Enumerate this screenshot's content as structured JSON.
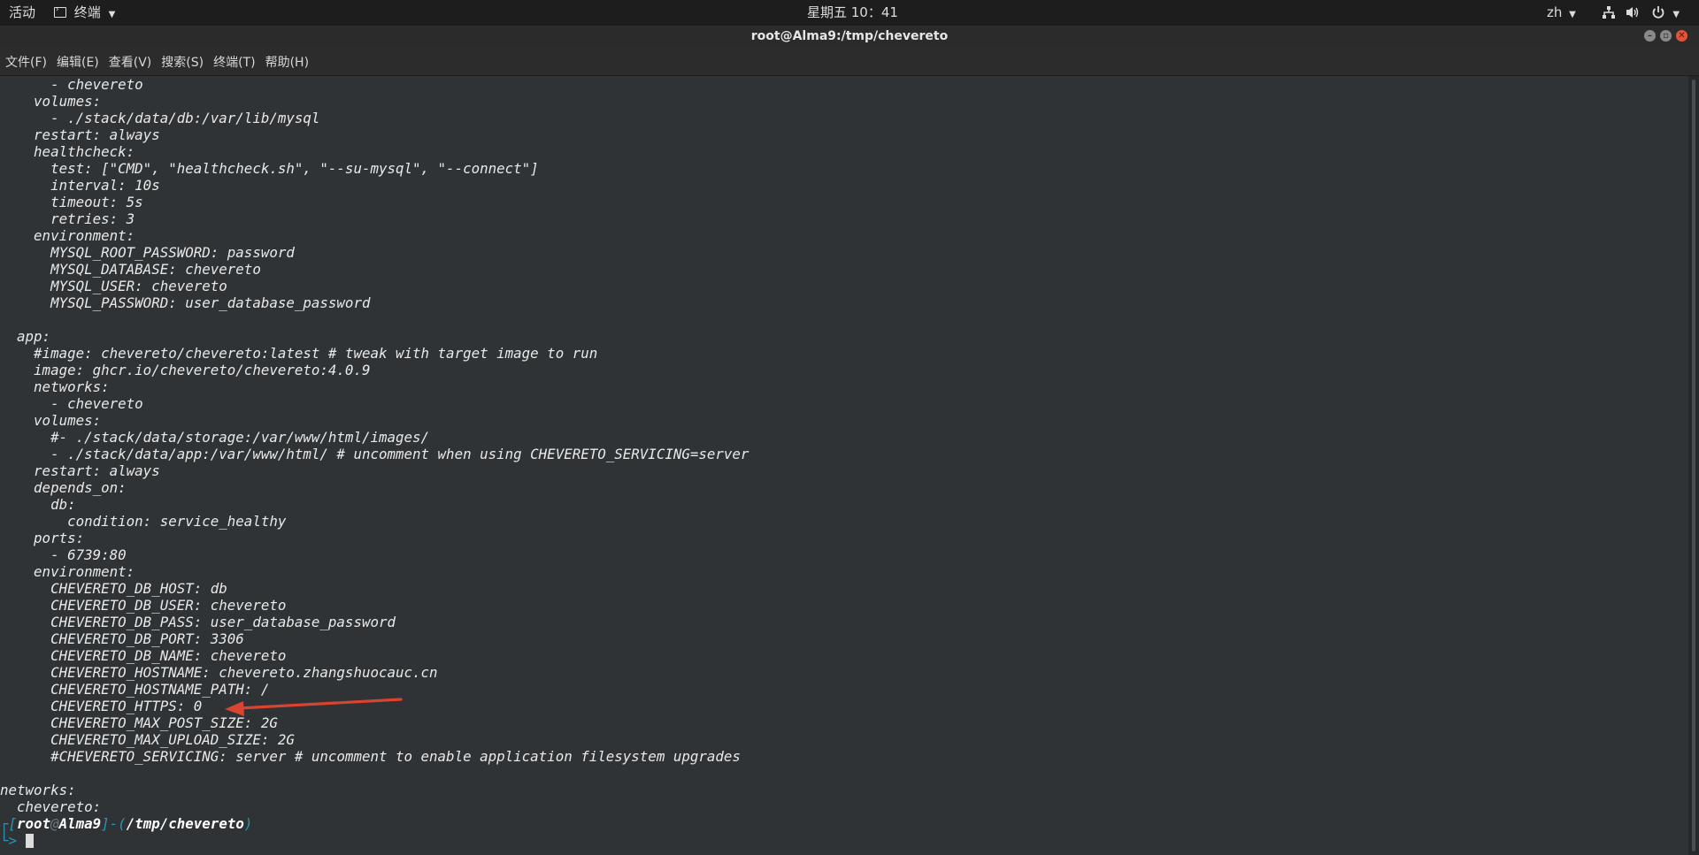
{
  "topbar": {
    "activities": "活动",
    "app_menu": "终端",
    "clock": "星期五 10：41",
    "input_method": "zh"
  },
  "window": {
    "title": "root@Alma9:/tmp/chevereto"
  },
  "menubar": {
    "items": [
      "文件(F)",
      "编辑(E)",
      "查看(V)",
      "搜索(S)",
      "终端(T)",
      "帮助(H)"
    ]
  },
  "terminal": {
    "lines": [
      "      - chevereto",
      "    volumes:",
      "      - ./stack/data/db:/var/lib/mysql",
      "    restart: always",
      "    healthcheck:",
      "      test: [\"CMD\", \"healthcheck.sh\", \"--su-mysql\", \"--connect\"]",
      "      interval: 10s",
      "      timeout: 5s",
      "      retries: 3",
      "    environment:",
      "      MYSQL_ROOT_PASSWORD: password",
      "      MYSQL_DATABASE: chevereto",
      "      MYSQL_USER: chevereto",
      "      MYSQL_PASSWORD: user_database_password",
      "",
      "  app:",
      "    #image: chevereto/chevereto:latest # tweak with target image to run",
      "    image: ghcr.io/chevereto/chevereto:4.0.9",
      "    networks:",
      "      - chevereto",
      "    volumes:",
      "      #- ./stack/data/storage:/var/www/html/images/",
      "      - ./stack/data/app:/var/www/html/ # uncomment when using CHEVERETO_SERVICING=server",
      "    restart: always",
      "    depends_on:",
      "      db:",
      "        condition: service_healthy",
      "    ports:",
      "      - 6739:80",
      "    environment:",
      "      CHEVERETO_DB_HOST: db",
      "      CHEVERETO_DB_USER: chevereto",
      "      CHEVERETO_DB_PASS: user_database_password",
      "      CHEVERETO_DB_PORT: 3306",
      "      CHEVERETO_DB_NAME: chevereto",
      "      CHEVERETO_HOSTNAME: chevereto.zhangshuocauc.cn",
      "      CHEVERETO_HOSTNAME_PATH: /",
      "      CHEVERETO_HTTPS: 0",
      "      CHEVERETO_MAX_POST_SIZE: 2G",
      "      CHEVERETO_MAX_UPLOAD_SIZE: 2G",
      "      #CHEVERETO_SERVICING: server # uncomment to enable application filesystem upgrades",
      "",
      "networks:",
      "  chevereto:"
    ],
    "prompt": {
      "open_bracket": "┌[",
      "user": "root",
      "at": "@",
      "host": "Alma9",
      "mid": "]-(",
      "path": "/tmp/chevereto",
      "close": ")",
      "second_line": "└> "
    }
  },
  "colors": {
    "terminal_bg": "#2f3336",
    "text": "#e9e9e9",
    "prompt_accent": "#2a95b6",
    "arrow": "#d9432f",
    "close_button": "#e2553a"
  },
  "icons": {
    "terminal": "terminal-icon",
    "network": "network-icon",
    "volume": "volume-icon",
    "power": "power-icon",
    "minimize": "minimize-icon",
    "maximize": "maximize-icon",
    "close": "close-icon"
  }
}
